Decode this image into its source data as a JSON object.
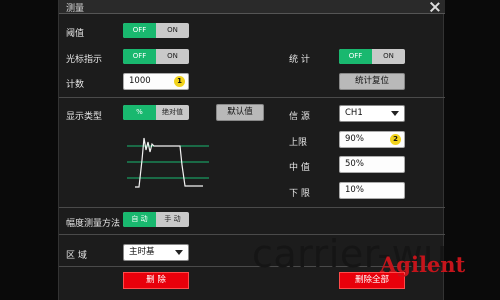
{
  "window": {
    "title": "测量"
  },
  "rows": {
    "threshold": {
      "label": "阈值",
      "toggle": {
        "off": "OFF",
        "on": "ON",
        "active": "OFF"
      }
    },
    "cursor": {
      "label": "光标指示",
      "toggle": {
        "off": "OFF",
        "on": "ON",
        "active": "OFF"
      }
    },
    "stats": {
      "label": "统 计",
      "toggle": {
        "off": "OFF",
        "on": "ON",
        "active": "OFF"
      }
    },
    "count": {
      "label": "计数",
      "value": "1000",
      "badge": "1"
    },
    "stats_reset": {
      "label": "统计复位"
    }
  },
  "display": {
    "label": "显示类型",
    "toggle": {
      "pct": "%",
      "abs": "绝对值",
      "active": "%"
    },
    "default_button": "默认值",
    "source": {
      "label": "信 源",
      "value": "CH1"
    },
    "upper": {
      "label": "上限",
      "value": "90%",
      "badge": "2"
    },
    "middle": {
      "label": "中 值",
      "value": "50%"
    },
    "lower": {
      "label": "下 限",
      "value": "10%"
    }
  },
  "amplitude": {
    "label": "幅度测量方法",
    "toggle": {
      "auto": "自 动",
      "manual": "手 动",
      "active": "自 动"
    }
  },
  "region": {
    "label": "区 域",
    "value": "主时基"
  },
  "actions": {
    "delete": "删 除",
    "delete_all": "删除全部"
  },
  "overlay": {
    "watermark": "carrier-wu",
    "logo": "Agilent"
  },
  "colors": {
    "accent_green": "#19b86f",
    "danger_red": "#e8000b",
    "badge_yellow": "#f2d31c"
  }
}
